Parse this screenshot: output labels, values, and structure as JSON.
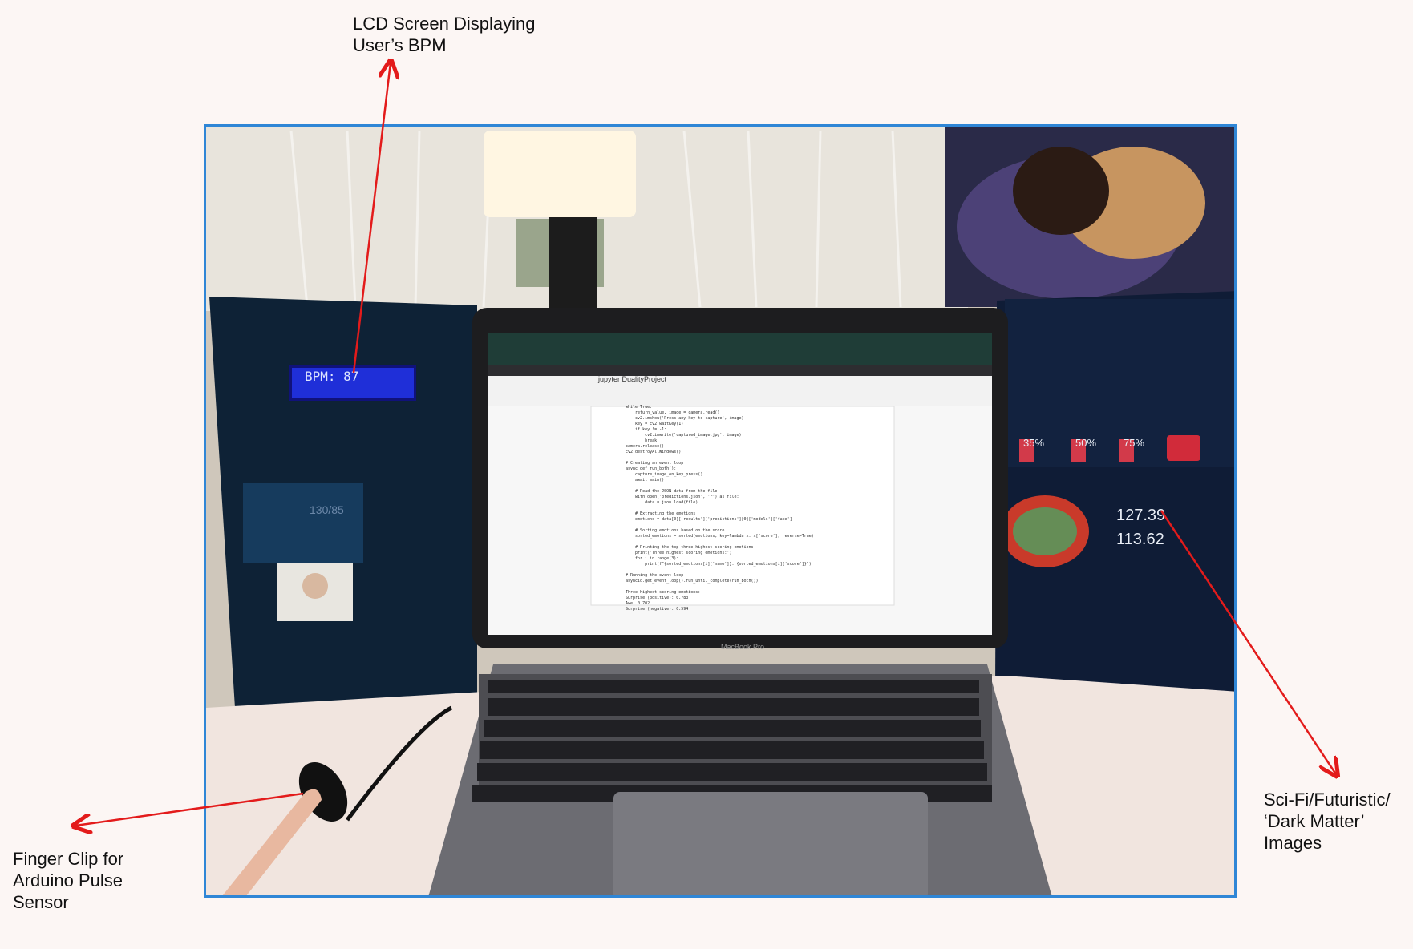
{
  "annotations": {
    "lcd": "LCD Screen Displaying\nUser’s BPM",
    "finger": "Finger Clip for\nArduino Pulse\nSensor",
    "scifi": "Sci-Fi/Futuristic/\n‘Dark Matter’\nImages"
  },
  "photo": {
    "lcd_readout": "BPM: 87",
    "notebook_title": "jupyter DualityProject",
    "laptop_brand": "MacBook Pro",
    "poster_value_1": "127.39",
    "poster_value_2": "113.62",
    "poster_pct_1": "35%",
    "poster_pct_2": "50%",
    "poster_pct_3": "75%",
    "poster_left_reading": "130/85",
    "code_text": "while True:\n    return_value, image = camera.read()\n    cv2.imshow('Press any key to capture', image)\n    key = cv2.waitKey(1)\n    if key != -1:\n        cv2.imwrite('captured_image.jpg', image)\n        break\ncamera.release()\ncv2.destroyAllWindows()\n\n# Creating an event loop\nasync def run_both():\n    capture_image_on_key_press()\n    await main()\n\n    # Read the JSON data from the file\n    with open('predictions.json', 'r') as file:\n        data = json.load(file)\n\n    # Extracting the emotions\n    emotions = data[0]['results']['predictions'][0]['models']['face']\n\n    # Sorting emotions based on the score\n    sorted_emotions = sorted(emotions, key=lambda x: x['score'], reverse=True)\n\n    # Printing the top three highest scoring emotions\n    print('Three highest scoring emotions:')\n    for i in range(3):\n        print(f\"{sorted_emotions[i]['name']}: {sorted_emotions[i]['score']}\")\n\n# Running the event loop\nasyncio.get_event_loop().run_until_complete(run_both())\n\nThree highest scoring emotions:\nSurprise (positive): 0.783\nAwe: 0.702\nSurprise (negative): 0.594"
  },
  "colors": {
    "arrow": "#e31b1b",
    "frame": "#2f86d6",
    "lcd_bg": "#1f2fd8"
  }
}
